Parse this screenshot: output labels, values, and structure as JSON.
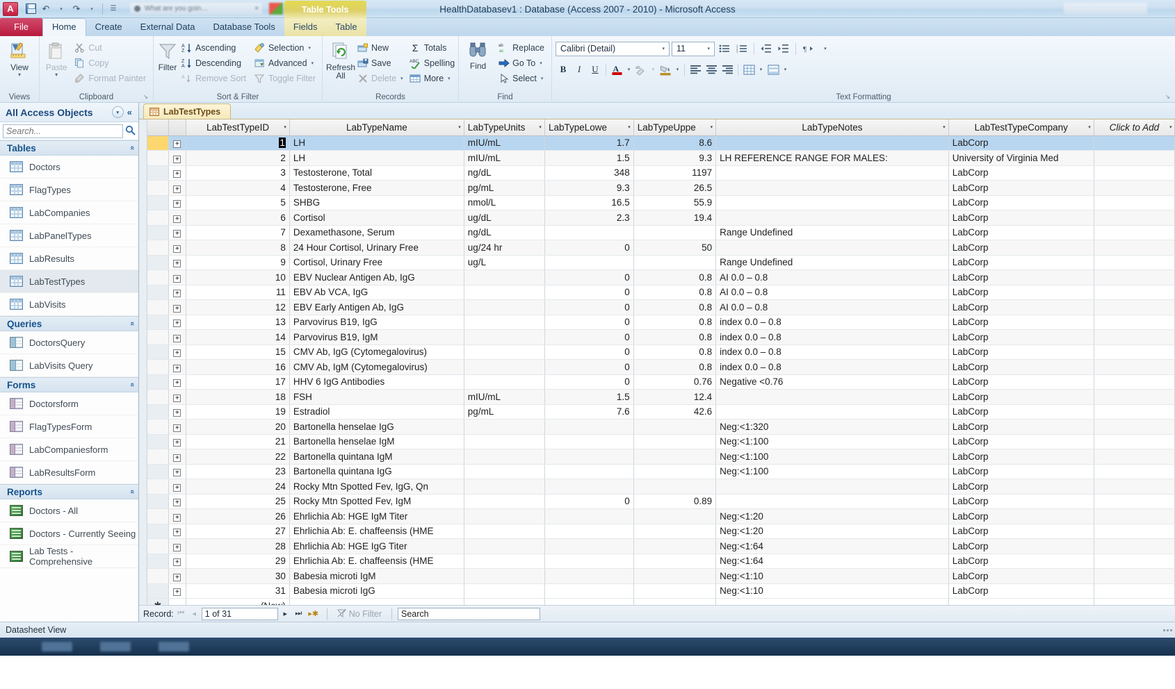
{
  "window": {
    "title": "HealthDatabasev1 : Database (Access 2007 - 2010)  -  Microsoft Access",
    "orb_label": "A"
  },
  "quick_access": {
    "save_title": "Save",
    "undo": "↶",
    "undo_arrow": "▾",
    "redo": "↷",
    "redo_arrow": "▾",
    "customize": "☰",
    "bg_tab_text": "What are you goin…",
    "bg_tab_close": "×"
  },
  "ribbon_tabs": {
    "file": "File",
    "items": [
      "Home",
      "Create",
      "External Data",
      "Database Tools"
    ],
    "active": "Home",
    "contextual_title": "Table Tools",
    "contextual_items": [
      "Fields",
      "Table"
    ]
  },
  "ribbon": {
    "views": {
      "label": "Views",
      "view_button": "View",
      "dropdown_arrow": "▾"
    },
    "clipboard": {
      "label": "Clipboard",
      "paste": "Paste",
      "paste_arrow": "▾",
      "cut": "Cut",
      "copy": "Copy",
      "format_painter": "Format Painter",
      "dialog_launcher": "↘"
    },
    "sort_filter": {
      "label": "Sort & Filter",
      "filter": "Filter",
      "ascending": "Ascending",
      "descending": "Descending",
      "remove_sort": "Remove Sort",
      "selection": "Selection",
      "advanced": "Advanced",
      "toggle_filter": "Toggle Filter",
      "dropdown_arrow": "▾"
    },
    "records": {
      "label": "Records",
      "refresh_all": "Refresh",
      "refresh_all_2": "All",
      "refresh_arrow": "▾",
      "new": "New",
      "save": "Save",
      "delete": "Delete",
      "delete_arrow": "▾",
      "totals": "Totals",
      "spelling": "Spelling",
      "more": "More",
      "more_arrow": "▾"
    },
    "find": {
      "label": "Find",
      "find": "Find",
      "replace": "Replace",
      "go_to": "Go To",
      "go_to_arrow": "▾",
      "select": "Select",
      "select_arrow": "▾"
    },
    "text_formatting": {
      "label": "Text Formatting",
      "font_name": "Calibri (Detail)",
      "font_size": "11",
      "dropdown_arrow": "▾",
      "bold": "B",
      "italic": "I",
      "underline": "U",
      "font_color": "A",
      "highlight": "ab",
      "fill_color": "◆",
      "align_left": "≡",
      "align_center": "≡",
      "align_right": "≡",
      "gridlines": "▦",
      "alt_fill": "▤",
      "bullets": "☰",
      "numbering": "☰",
      "dec_indent": "←",
      "inc_indent": "→",
      "text_direction": "¶",
      "dialog_launcher": "↘"
    }
  },
  "nav_pane": {
    "title": "All Access Objects",
    "dropdown": "▾",
    "collapse": "«",
    "search_placeholder": "Search...",
    "search_value": "",
    "search_icon": "🔍",
    "chevron": "«",
    "groups": [
      {
        "name": "Tables",
        "icon": "table",
        "items": [
          {
            "label": "Doctors",
            "selected": false
          },
          {
            "label": "FlagTypes",
            "selected": false
          },
          {
            "label": "LabCompanies",
            "selected": false
          },
          {
            "label": "LabPanelTypes",
            "selected": false
          },
          {
            "label": "LabResults",
            "selected": false
          },
          {
            "label": "LabTestTypes",
            "selected": true
          },
          {
            "label": "LabVisits",
            "selected": false
          }
        ]
      },
      {
        "name": "Queries",
        "icon": "query",
        "items": [
          {
            "label": "DoctorsQuery",
            "selected": false
          },
          {
            "label": "LabVisits Query",
            "selected": false
          }
        ]
      },
      {
        "name": "Forms",
        "icon": "form",
        "items": [
          {
            "label": "Doctorsform",
            "selected": false
          },
          {
            "label": "FlagTypesForm",
            "selected": false
          },
          {
            "label": "LabCompaniesform",
            "selected": false
          },
          {
            "label": "LabResultsForm",
            "selected": false
          }
        ]
      },
      {
        "name": "Reports",
        "icon": "report",
        "items": [
          {
            "label": "Doctors - All",
            "selected": false
          },
          {
            "label": "Doctors - Currently Seeing",
            "selected": false
          },
          {
            "label": "Lab Tests - Comprehensive",
            "selected": false
          }
        ]
      }
    ]
  },
  "document_tab": {
    "label": "LabTestTypes"
  },
  "datasheet": {
    "columns": [
      {
        "label": "LabTestTypeID",
        "selected": true
      },
      {
        "label": "LabTypeName",
        "selected": false
      },
      {
        "label": "LabTypeUnits",
        "selected": false
      },
      {
        "label": "LabTypeLowe",
        "selected": false
      },
      {
        "label": "LabTypeUppe",
        "selected": false
      },
      {
        "label": "LabTypeNotes",
        "selected": false
      },
      {
        "label": "LabTestTypeCompany",
        "selected": false
      }
    ],
    "click_to_add": "Click to Add",
    "expand_glyph": "+",
    "new_row_label": "(New)",
    "new_row_marker": "✱",
    "active_cell_value": "1",
    "rows": [
      {
        "id": "1",
        "name": "LH",
        "units": "mIU/mL",
        "low": "1.7",
        "up": "8.6",
        "notes": "",
        "company": "LabCorp"
      },
      {
        "id": "2",
        "name": "LH",
        "units": "mIU/mL",
        "low": "1.5",
        "up": "9.3",
        "notes": "LH REFERENCE RANGE FOR MALES:",
        "company": "University of Virginia Med"
      },
      {
        "id": "3",
        "name": "Testosterone, Total",
        "units": "ng/dL",
        "low": "348",
        "up": "1197",
        "notes": "",
        "company": "LabCorp"
      },
      {
        "id": "4",
        "name": "Testosterone, Free",
        "units": "pg/mL",
        "low": "9.3",
        "up": "26.5",
        "notes": "",
        "company": "LabCorp"
      },
      {
        "id": "5",
        "name": "SHBG",
        "units": "nmol/L",
        "low": "16.5",
        "up": "55.9",
        "notes": "",
        "company": "LabCorp"
      },
      {
        "id": "6",
        "name": "Cortisol",
        "units": "ug/dL",
        "low": "2.3",
        "up": "19.4",
        "notes": "",
        "company": "LabCorp"
      },
      {
        "id": "7",
        "name": "Dexamethasone, Serum",
        "units": "ng/dL",
        "low": "",
        "up": "",
        "notes": "Range Undefined",
        "company": "LabCorp"
      },
      {
        "id": "8",
        "name": "24 Hour Cortisol, Urinary Free",
        "units": "ug/24 hr",
        "low": "0",
        "up": "50",
        "notes": "",
        "company": "LabCorp"
      },
      {
        "id": "9",
        "name": "Cortisol, Urinary Free",
        "units": "ug/L",
        "low": "",
        "up": "",
        "notes": "Range Undefined",
        "company": "LabCorp"
      },
      {
        "id": "10",
        "name": "EBV Nuclear Antigen Ab, IgG",
        "units": "",
        "low": "0",
        "up": "0.8",
        "notes": "AI 0.0 – 0.8",
        "company": "LabCorp"
      },
      {
        "id": "11",
        "name": "EBV Ab VCA, IgG",
        "units": "",
        "low": "0",
        "up": "0.8",
        "notes": "AI 0.0 – 0.8",
        "company": "LabCorp"
      },
      {
        "id": "12",
        "name": "EBV Early Antigen Ab, IgG",
        "units": "",
        "low": "0",
        "up": "0.8",
        "notes": "AI 0.0 – 0.8",
        "company": "LabCorp"
      },
      {
        "id": "13",
        "name": "Parvovirus B19, IgG",
        "units": "",
        "low": "0",
        "up": "0.8",
        "notes": "index 0.0 – 0.8",
        "company": "LabCorp"
      },
      {
        "id": "14",
        "name": "Parvovirus B19, IgM",
        "units": "",
        "low": "0",
        "up": "0.8",
        "notes": "index 0.0 – 0.8",
        "company": "LabCorp"
      },
      {
        "id": "15",
        "name": "CMV Ab, IgG (Cytomegalovirus)",
        "units": "",
        "low": "0",
        "up": "0.8",
        "notes": "index 0.0 – 0.8",
        "company": "LabCorp"
      },
      {
        "id": "16",
        "name": "CMV Ab, IgM (Cytomegalovirus)",
        "units": "",
        "low": "0",
        "up": "0.8",
        "notes": "index 0.0 – 0.8",
        "company": "LabCorp"
      },
      {
        "id": "17",
        "name": "HHV 6 IgG Antibodies",
        "units": "",
        "low": "0",
        "up": "0.76",
        "notes": "Negative <0.76",
        "company": "LabCorp"
      },
      {
        "id": "18",
        "name": "FSH",
        "units": "mIU/mL",
        "low": "1.5",
        "up": "12.4",
        "notes": "",
        "company": "LabCorp"
      },
      {
        "id": "19",
        "name": "Estradiol",
        "units": "pg/mL",
        "low": "7.6",
        "up": "42.6",
        "notes": "",
        "company": "LabCorp"
      },
      {
        "id": "20",
        "name": "Bartonella henselae IgG",
        "units": "",
        "low": "",
        "up": "",
        "notes": "Neg:<1:320",
        "company": "LabCorp"
      },
      {
        "id": "21",
        "name": "Bartonella henselae IgM",
        "units": "",
        "low": "",
        "up": "",
        "notes": "Neg:<1:100",
        "company": "LabCorp"
      },
      {
        "id": "22",
        "name": "Bartonella quintana IgM",
        "units": "",
        "low": "",
        "up": "",
        "notes": "Neg:<1:100",
        "company": "LabCorp"
      },
      {
        "id": "23",
        "name": "Bartonella quintana IgG",
        "units": "",
        "low": "",
        "up": "",
        "notes": "Neg:<1:100",
        "company": "LabCorp"
      },
      {
        "id": "24",
        "name": "Rocky Mtn Spotted Fev, IgG, Qn",
        "units": "",
        "low": "",
        "up": "",
        "notes": "",
        "company": "LabCorp"
      },
      {
        "id": "25",
        "name": "Rocky Mtn Spotted Fev, IgM",
        "units": "",
        "low": "0",
        "up": "0.89",
        "notes": "",
        "company": "LabCorp"
      },
      {
        "id": "26",
        "name": "Ehrlichia Ab: HGE IgM Titer",
        "units": "",
        "low": "",
        "up": "",
        "notes": "Neg:<1:20",
        "company": "LabCorp"
      },
      {
        "id": "27",
        "name": "Ehrlichia Ab: E. chaffeensis (HME",
        "units": "",
        "low": "",
        "up": "",
        "notes": "Neg:<1:20",
        "company": "LabCorp"
      },
      {
        "id": "28",
        "name": "Ehrlichia Ab: HGE IgG Titer",
        "units": "",
        "low": "",
        "up": "",
        "notes": "Neg:<1:64",
        "company": "LabCorp"
      },
      {
        "id": "29",
        "name": "Ehrlichia Ab: E. chaffeensis (HME",
        "units": "",
        "low": "",
        "up": "",
        "notes": "Neg:<1:64",
        "company": "LabCorp"
      },
      {
        "id": "30",
        "name": "Babesia microti IgM",
        "units": "",
        "low": "",
        "up": "",
        "notes": "Neg:<1:10",
        "company": "LabCorp"
      },
      {
        "id": "31",
        "name": "Babesia microti IgG",
        "units": "",
        "low": "",
        "up": "",
        "notes": "Neg:<1:10",
        "company": "LabCorp"
      }
    ]
  },
  "record_nav": {
    "label": "Record:",
    "first": "⏮",
    "prev": "◂",
    "position": "1 of 31",
    "next": "▸",
    "last": "⏭",
    "new_record": "▸✱",
    "filter_icon": "⊘",
    "filter_label": "No Filter",
    "search_label": "Search",
    "search_placeholder": "Search"
  },
  "status_bar": {
    "text": "Datasheet View"
  }
}
